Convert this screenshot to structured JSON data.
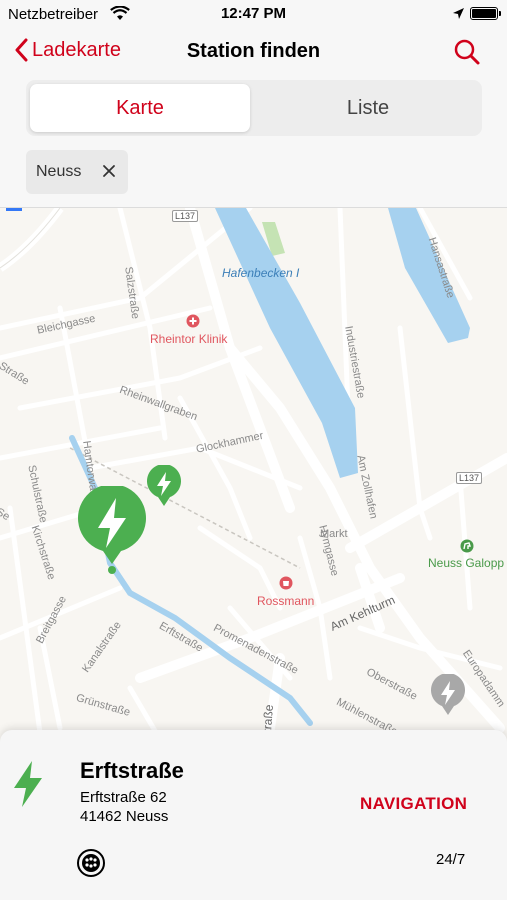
{
  "status_bar": {
    "carrier": "Netzbetreiber",
    "time": "12:47 PM"
  },
  "nav": {
    "back_label": "Ladekarte",
    "title": "Station finden"
  },
  "segments": {
    "map": "Karte",
    "list": "Liste"
  },
  "filter_chip": {
    "label": "Neuss"
  },
  "map_labels": {
    "l137_a": "L137",
    "l137_b": "L137",
    "hafenbecken": "Hafenbecken I",
    "hansastrasse": "Hansastraße",
    "salzstrasse": "Salzstraße",
    "bleichgasse": "Bleichgasse",
    "rheintor_klinik": "Rheintor Klinik",
    "industriestrasse": "Industriestraße",
    "strasse_left": "-Straße",
    "rheinwallgraben": "Rheinwallgraben",
    "hamtorwall": "Hamtorwall",
    "glockhammer": "Glockhammer",
    "am_zollhafen": "Am Zollhafen",
    "schulstrasse": "Schulstraße",
    "kirchstrasse": "Kirchstraße",
    "se": "Se",
    "markt": "Markt",
    "hymgasse": "Hymgasse",
    "neuss_galopp": "Neuss Galopp",
    "rossmann": "Rossmann",
    "am_kehlturm": "Am Kehlturm",
    "erftstrasse_map": "Erftstraße",
    "promenadenstrasse": "Promenadenstraße",
    "oberstrasse": "Oberstraße",
    "europadamm": "Europadamm",
    "breitgasse": "Breitgasse",
    "kanalstrasse": "Kanalstraße",
    "muehlenstrasse": "Mühlenstraße",
    "gruenstrasse": "Grünstraße",
    "strasse_bottom": "traße"
  },
  "station": {
    "name": "Erftstraße",
    "street": "Erftstraße 62",
    "city": "41462 Neuss",
    "navigation_label": "NAVIGATION",
    "hours": "24/7"
  },
  "colors": {
    "accent": "#d0021b",
    "station_green": "#4caf50",
    "water": "#a6d1ef",
    "map_bg": "#f8f6f2"
  },
  "icons": [
    "wifi-icon",
    "location-arrow-icon",
    "battery-icon",
    "chevron-left-icon",
    "search-icon",
    "close-icon",
    "charging-pin-icon",
    "bolt-icon",
    "plug-type-icon",
    "hospital-icon",
    "shop-icon",
    "horse-icon"
  ]
}
